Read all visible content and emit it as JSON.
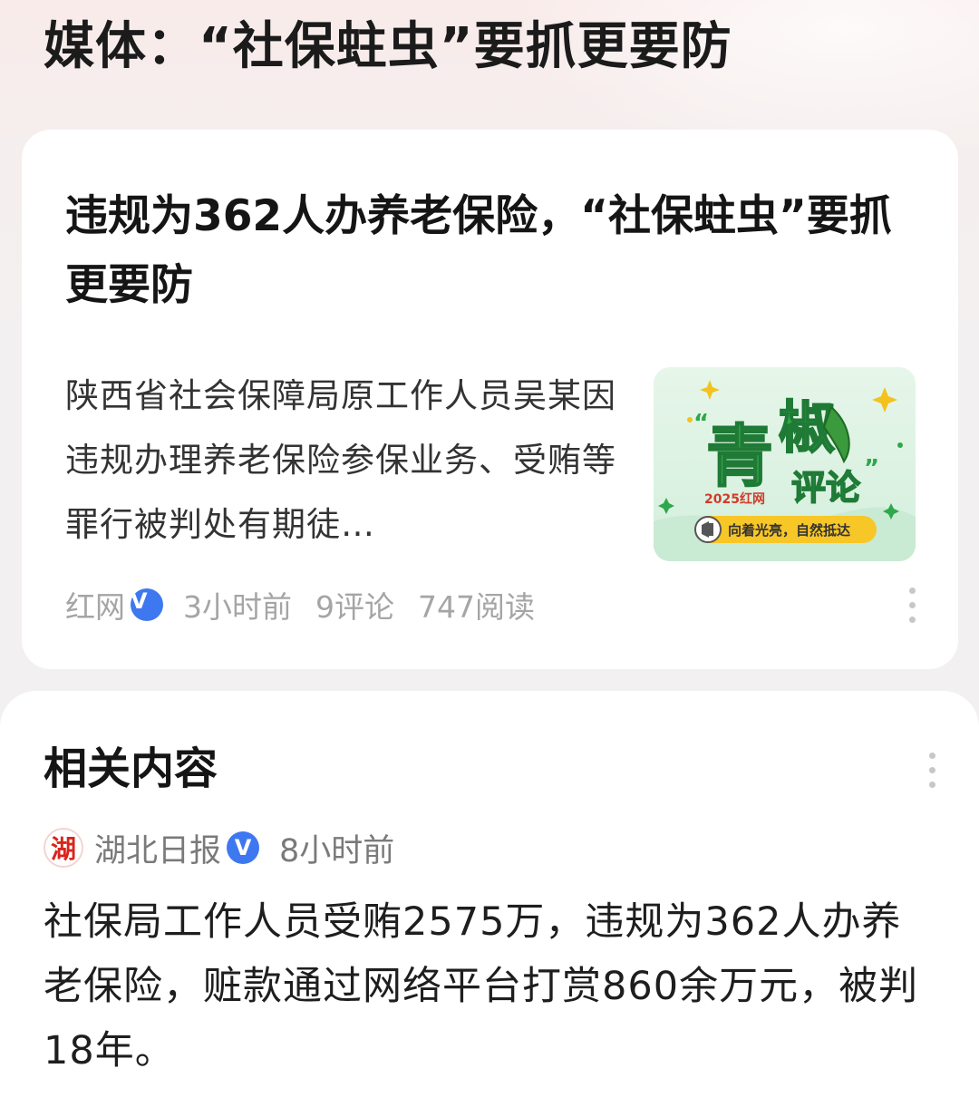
{
  "page": {
    "title": "媒体：“社保蛀虫”要抓更要防"
  },
  "article": {
    "headline": "违规为362人办养老保险，“社保蛀虫”要抓更要防",
    "summary": "陕西省社会保障局原工作人员吴某因违规办理养老保险参保业务、受贿等罪行被判处有期徒…",
    "thumbnail": {
      "title_big": "青椒",
      "title_small": "评论",
      "tag": "2025红网",
      "slogan": "向着光亮，自然抵达",
      "colors": {
        "bg": "#dff3e6",
        "green": "#2ea84a",
        "yellow": "#f7c627"
      }
    },
    "source": "红网",
    "verified_icon": "verified-v-icon",
    "verified_mark": "V",
    "time": "3小时前",
    "comments": "9评论",
    "reads": "747阅读"
  },
  "related": {
    "title": "相关内容",
    "source_logo_text": "湖",
    "source": "湖北日报",
    "verified_mark": "V",
    "time": "8小时前",
    "text": "社保局工作人员受贿2575万，违规为362人办养老保险，赃款通过网络平台打赏860余万元，被判18年。"
  },
  "colors": {
    "verified_blue": "#3e78f0",
    "meta_gray": "#a5a5a5",
    "logo_red": "#d9241c"
  }
}
